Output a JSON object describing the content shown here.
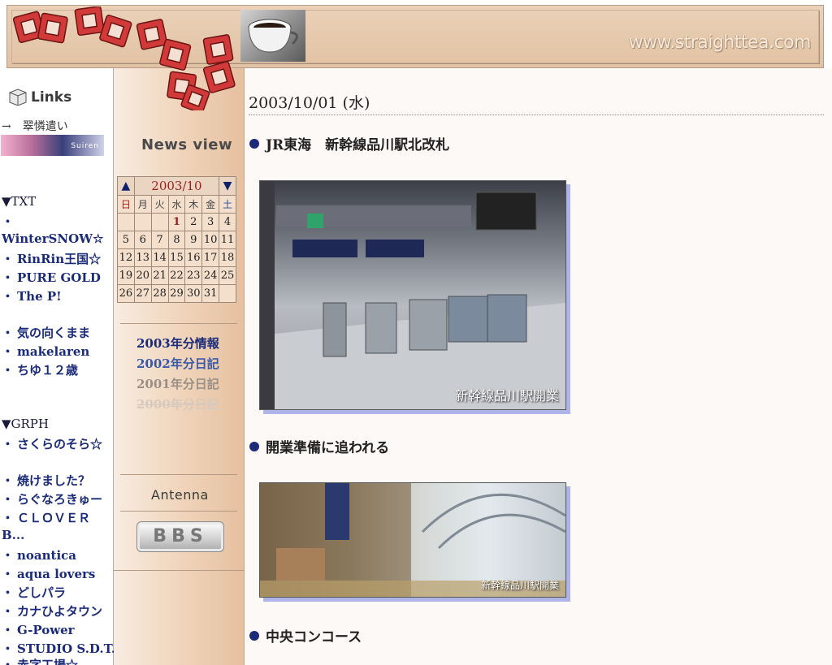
{
  "header": {
    "site_url": "www.straighttea.com"
  },
  "sidebar": {
    "links_heading": "Links",
    "arrow_link": "→　翠憐遣い",
    "banner_text": "Suiren",
    "sections": [
      {
        "title": "▼TXT",
        "items": [
          "WinterSNOW☆",
          "RinRin王国☆",
          "PURE GOLD",
          "The P!",
          "気の向くまま",
          "makelaren",
          "ちゆ１２歳"
        ]
      },
      {
        "title": "▼GRPH",
        "items": [
          "さくらのそら☆",
          "焼けました？",
          "らぐなろきゅー",
          "ＣＬＯＶＥＲ",
          "B...",
          "noantica",
          "aqua lovers",
          "どしパラ",
          "カナひよタウン",
          "G-Power",
          "STUDIO S.D.T.",
          "赤字工場☆"
        ]
      }
    ]
  },
  "middle": {
    "news_view": "News view",
    "calendar": {
      "month_label": "2003/10",
      "prev": "▲",
      "next": "▼",
      "weekdays": [
        "日",
        "月",
        "火",
        "水",
        "木",
        "金",
        "土"
      ],
      "weeks": [
        [
          "",
          "",
          "",
          "1",
          "2",
          "3",
          "4"
        ],
        [
          "5",
          "6",
          "7",
          "8",
          "9",
          "10",
          "11"
        ],
        [
          "12",
          "13",
          "14",
          "15",
          "16",
          "17",
          "18"
        ],
        [
          "19",
          "20",
          "21",
          "22",
          "23",
          "24",
          "25"
        ],
        [
          "26",
          "27",
          "28",
          "29",
          "30",
          "31",
          ""
        ]
      ],
      "highlight": "1"
    },
    "year_links": [
      {
        "label": "2003年分情報",
        "color": "#1a2b7a"
      },
      {
        "label": "2002年分日記",
        "color": "#3a58a8"
      },
      {
        "label": "2001年分日記",
        "color": "#9a8f86"
      },
      {
        "label": "2000年分日記",
        "color": "#d7c9bc"
      }
    ],
    "antenna": "Antenna",
    "bbs": "BBS"
  },
  "main": {
    "date_title": "2003/10/01 (水)",
    "topics": [
      "JR東海　新幹線品川駅北改札",
      "開業準備に追われる",
      "中央コンコース"
    ],
    "photo1_caption": "新幹線品川駅開業",
    "photo2_caption": "新幹線品川駅開業",
    "accent_color": "#1b2a78"
  }
}
